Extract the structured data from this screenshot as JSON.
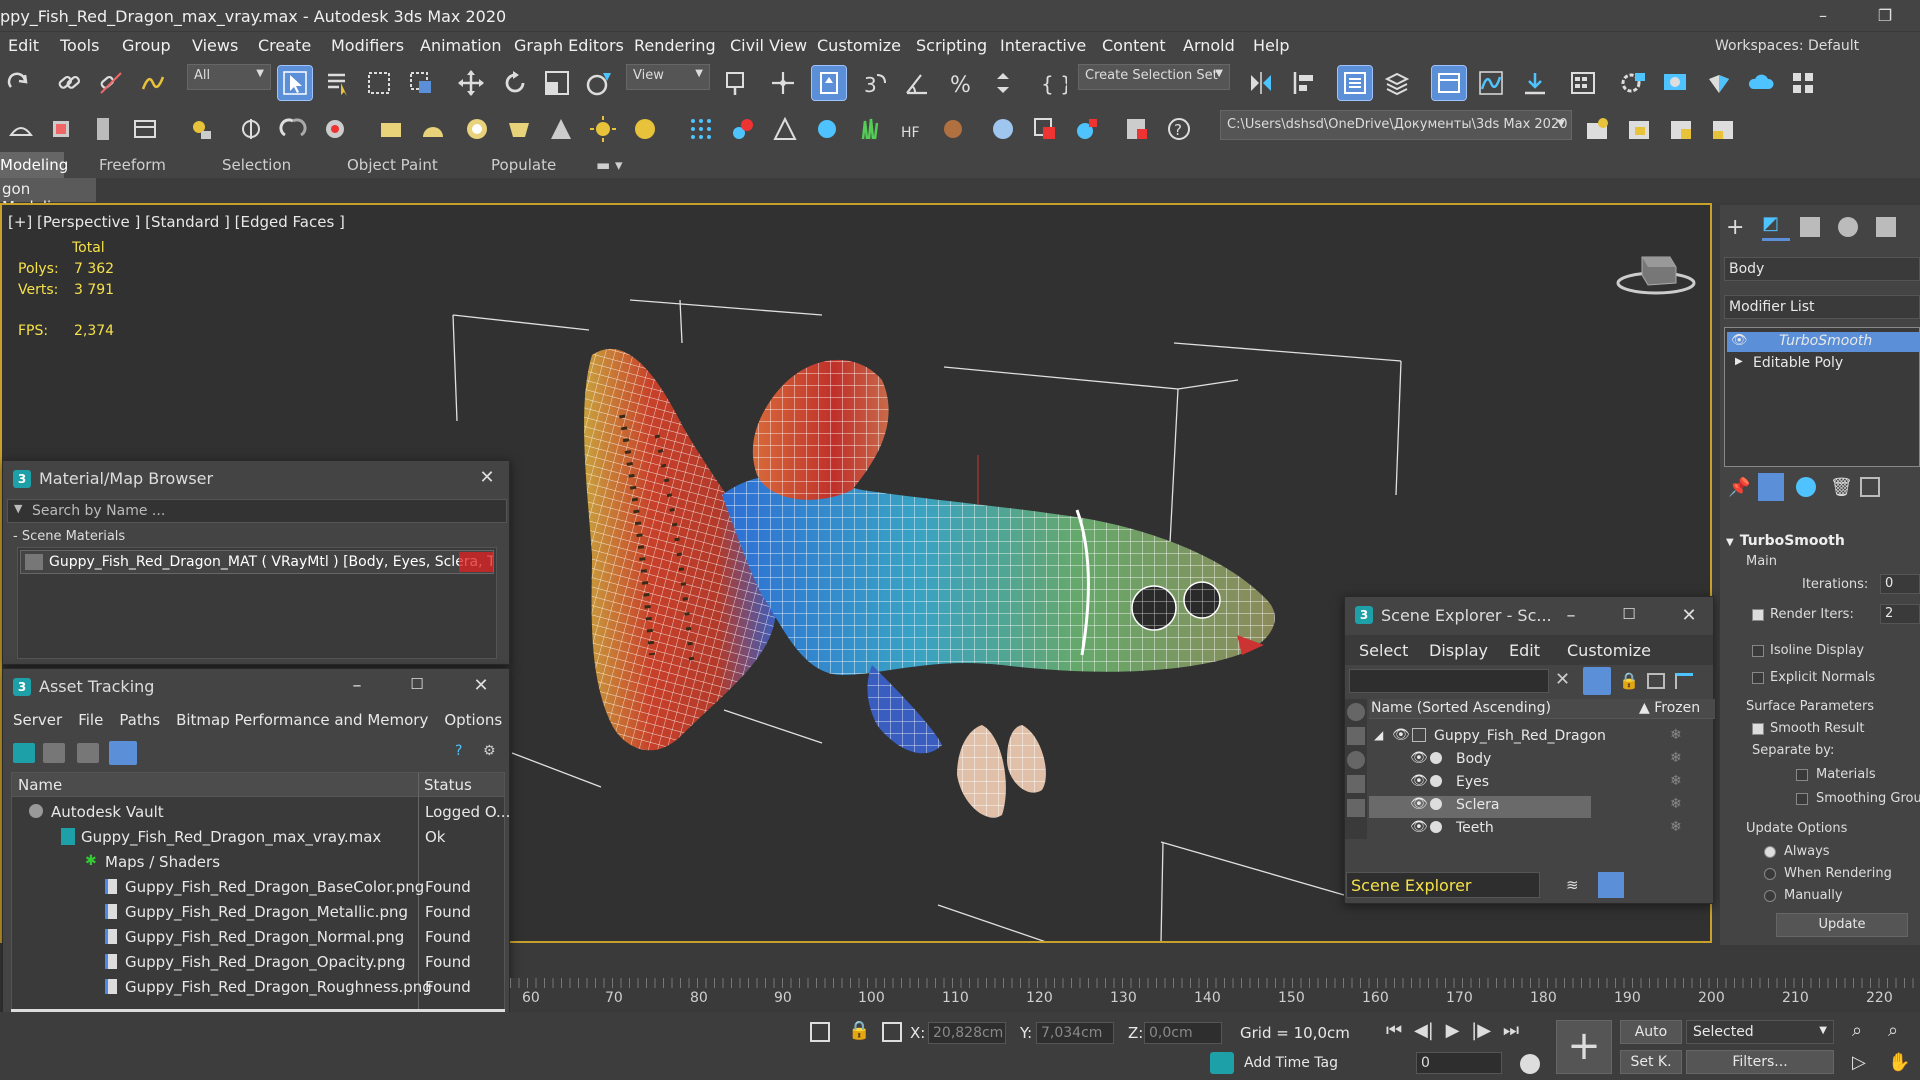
{
  "window": {
    "title": "ppy_Fish_Red_Dragon_max_vray.max - Autodesk 3ds Max 2020",
    "minimize": "–",
    "restore": "❐"
  },
  "menu": {
    "items": [
      "Edit",
      "Tools",
      "Group",
      "Views",
      "Create",
      "Modifiers",
      "Animation",
      "Graph Editors",
      "Rendering",
      "Civil View",
      "Customize",
      "Scripting",
      "Interactive",
      "Content",
      "Arnold",
      "Help"
    ],
    "workspaces_label": "Workspaces:",
    "workspaces_value": "Default"
  },
  "toolbar": {
    "filter_value": "All",
    "view_value": "View",
    "selection_set": "Create Selection Set",
    "path": "C:\\Users\\dshsd\\OneDrive\\Документы\\3ds Max 2020"
  },
  "ribbon": {
    "tabs": [
      "Modeling",
      "Freeform",
      "Selection",
      "Object Paint",
      "Populate"
    ],
    "sub": "gon Modeling"
  },
  "viewport": {
    "label": "[+] [Perspective ] [Standard ] [Edged Faces ]",
    "stats_header": "Total",
    "polys_label": "Polys:",
    "polys_value": "7 362",
    "verts_label": "Verts:",
    "verts_value": "3 791",
    "fps_label": "FPS:",
    "fps_value": "2,374"
  },
  "material_browser": {
    "title": "Material/Map Browser",
    "search_placeholder": "Search by Name ...",
    "section": "- Scene Materials",
    "material": "Guppy_Fish_Red_Dragon_MAT  ( VRayMtl )  [Body, Eyes, Sclera, Te..."
  },
  "asset_tracking": {
    "title": "Asset Tracking",
    "menu": [
      "Server",
      "File",
      "Paths",
      "Bitmap Performance and Memory",
      "Options"
    ],
    "col_name": "Name",
    "col_status": "Status",
    "rows": [
      {
        "name": "Autodesk Vault",
        "status": "Logged O..."
      },
      {
        "name": "Guppy_Fish_Red_Dragon_max_vray.max",
        "status": "Ok"
      },
      {
        "name": "Maps / Shaders",
        "status": ""
      },
      {
        "name": "Guppy_Fish_Red_Dragon_BaseColor.png",
        "status": "Found"
      },
      {
        "name": "Guppy_Fish_Red_Dragon_Metallic.png",
        "status": "Found"
      },
      {
        "name": "Guppy_Fish_Red_Dragon_Normal.png",
        "status": "Found"
      },
      {
        "name": "Guppy_Fish_Red_Dragon_Opacity.png",
        "status": "Found"
      },
      {
        "name": "Guppy_Fish_Red_Dragon_Roughness.png",
        "status": "Found"
      }
    ]
  },
  "scene_explorer": {
    "title": "Scene Explorer - Sc...",
    "menu": [
      "Select",
      "Display",
      "Edit",
      "Customize"
    ],
    "col_name": "Name (Sorted Ascending)",
    "col_frozen": "▲ Frozen",
    "root": "Guppy_Fish_Red_Dragon",
    "children": [
      "Body",
      "Eyes",
      "Sclera",
      "Teeth"
    ],
    "footer": "Scene Explorer"
  },
  "command_panel": {
    "object_name": "Body",
    "modifier_list": "Modifier List",
    "stack": [
      "TurboSmooth",
      "Editable Poly"
    ],
    "rollout": "TurboSmooth",
    "main": "Main",
    "iterations_label": "Iterations:",
    "iterations_value": "0",
    "render_iters_label": "Render Iters:",
    "render_iters_value": "2",
    "isoline": "Isoline Display",
    "explicit": "Explicit Normals",
    "surface": "Surface Parameters",
    "smooth_result": "Smooth Result",
    "separate": "Separate by:",
    "materials": "Materials",
    "smoothing": "Smoothing Groups",
    "update_options": "Update Options",
    "always": "Always",
    "when_rendering": "When Rendering",
    "manually": "Manually",
    "update": "Update"
  },
  "timeline": {
    "ticks": [
      "60",
      "70",
      "80",
      "90",
      "100",
      "110",
      "120",
      "130",
      "140",
      "150",
      "160",
      "170",
      "180",
      "190",
      "200",
      "210",
      "220"
    ]
  },
  "status": {
    "x_label": "X:",
    "x_value": "20,828cm",
    "y_label": "Y:",
    "y_value": "7,034cm",
    "z_label": "Z:",
    "z_value": "0,0cm",
    "grid": "Grid = 10,0cm",
    "add_time_tag": "Add Time Tag",
    "frame": "0",
    "auto": "Auto",
    "set_key": "Set K.",
    "selected": "Selected",
    "filters": "Filters..."
  }
}
